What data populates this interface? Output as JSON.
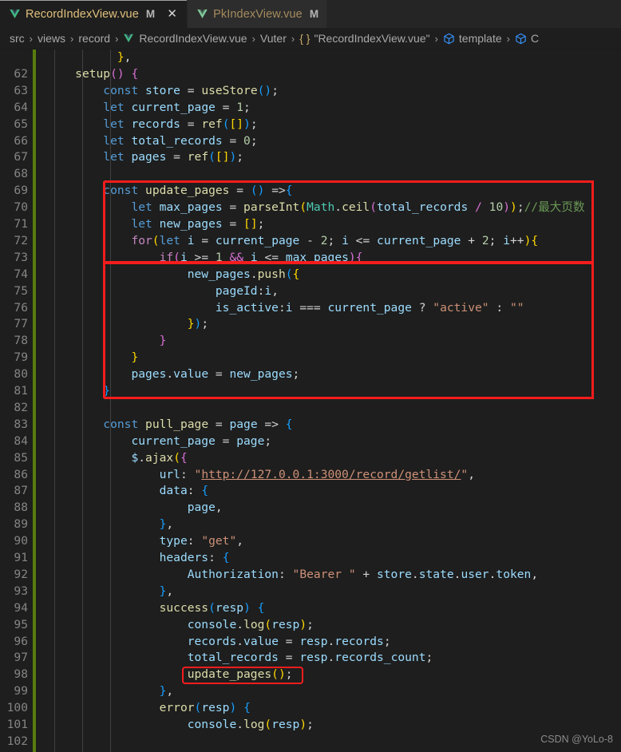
{
  "window": {
    "app": "vs-code-editor",
    "accent_red": "#f61c1c",
    "git_modified_color": "#587c0c",
    "background": "#1e1e1e"
  },
  "tabs": [
    {
      "icon": "vue-icon",
      "label": "RecordIndexView.vue",
      "dirty": "M",
      "close": "✕",
      "active": true
    },
    {
      "icon": "vue-icon",
      "label": "PkIndexView.vue",
      "dirty": "M",
      "close": "",
      "active": false
    }
  ],
  "breadcrumb": {
    "separator": "›",
    "items": [
      {
        "label": "src",
        "icon": ""
      },
      {
        "label": "views",
        "icon": ""
      },
      {
        "label": "record",
        "icon": ""
      },
      {
        "label": "RecordIndexView.vue",
        "icon": "vue-icon"
      },
      {
        "label": "Vuter",
        "icon": ""
      },
      {
        "label": "\"RecordIndexView.vue\"",
        "icon": "braces-icon"
      },
      {
        "label": "template",
        "icon": "cube-icon"
      },
      {
        "label": "C",
        "icon": "cube-icon"
      }
    ]
  },
  "editor": {
    "first_line": 62,
    "last_line": 102,
    "line_numbers": [
      62,
      63,
      64,
      65,
      66,
      67,
      68,
      69,
      70,
      71,
      72,
      73,
      74,
      75,
      76,
      77,
      78,
      79,
      80,
      81,
      82,
      83,
      84,
      85,
      86,
      87,
      88,
      89,
      90,
      91,
      92,
      93,
      94,
      95,
      96,
      97,
      98,
      99,
      100,
      101,
      102
    ],
    "code_lines": [
      "        },",
      "    setup() {",
      "        const store = useStore();",
      "        let current_page = 1;",
      "        let records = ref([]);",
      "        let total_records = 0;",
      "        let pages = ref([]);",
      "",
      "        const update_pages = () =>{",
      "            let max_pages = parseInt(Math.ceil(total_records / 10));//最大页数",
      "            let new_pages = [];",
      "            for(let i = current_page - 2; i <= current_page + 2; i++){",
      "                if(i >= 1 && i <= max_pages){",
      "                    new_pages.push({",
      "                        pageId:i,",
      "                        is_active:i === current_page ? \"active\" : \"\"",
      "                    });",
      "                }",
      "            }",
      "            pages.value = new_pages;",
      "        }",
      "",
      "        const pull_page = page => {",
      "            current_page = page;",
      "            $.ajax({",
      "                url: \"http://127.0.0.1:3000/record/getlist/\",",
      "                data: {",
      "                    page,",
      "                },",
      "                type: \"get\",",
      "                headers: {",
      "                    Authorization: \"Bearer \" + store.state.user.token,",
      "                },",
      "                success(resp) {",
      "                    console.log(resp);",
      "                    records.value = resp.records;",
      "                    total_records = resp.records_count;",
      "                    update_pages();",
      "                },",
      "                error(resp) {",
      "                    console.log(resp);"
    ]
  },
  "annotations": {
    "box_1_label": "update-pages-function-highlight",
    "box_2_label": "update-pages-call-highlight"
  },
  "watermark": {
    "text": "CSDN @YoLo-8"
  }
}
